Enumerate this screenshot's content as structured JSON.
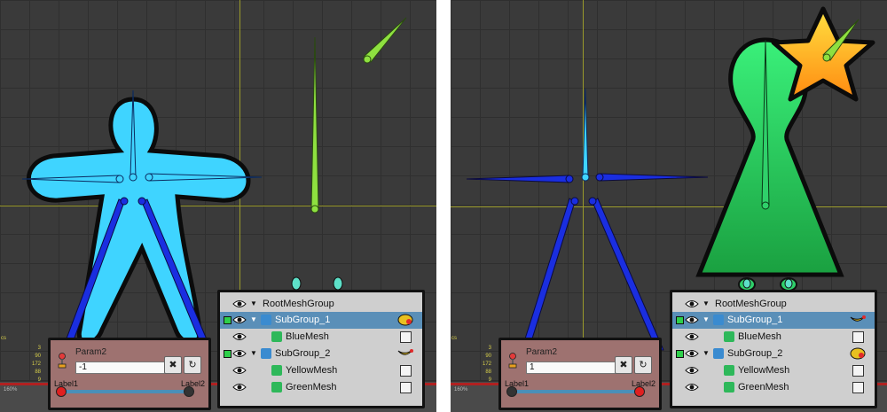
{
  "colors": {
    "viewport_bg": "#3a3a3a",
    "blue_body": "#3fd4ff",
    "blue_limb": "#1a2ee0",
    "green_bone": "#8ee040",
    "tree_green": "#2fd06a",
    "selection": "#5a8fb8",
    "param_panel": "#9e7270"
  },
  "left": {
    "param": {
      "name": "Param2",
      "value": "-1",
      "label_min": "Label1",
      "label_max": "Label2",
      "slider_position": 0.0,
      "reset_icon": "x-icon",
      "refresh_icon": "refresh-icon"
    },
    "zoom": "160%",
    "stats_label": "cs",
    "stats": [
      "3",
      "90",
      "172",
      "88",
      "9"
    ]
  },
  "right": {
    "param": {
      "name": "Param2",
      "value": "1",
      "label_min": "Label1",
      "label_max": "Label2",
      "slider_position": 1.0,
      "reset_icon": "x-icon",
      "refresh_icon": "refresh-icon"
    },
    "zoom": "160%",
    "stats_label": "cs",
    "stats": [
      "3",
      "90",
      "172",
      "88",
      "9"
    ]
  },
  "hierarchy": {
    "root": "RootMeshGroup",
    "items": [
      {
        "label": "SubGroup_1",
        "type": "group"
      },
      {
        "label": "BlueMesh",
        "type": "mesh"
      },
      {
        "label": "SubGroup_2",
        "type": "group"
      },
      {
        "label": "YellowMesh",
        "type": "mesh"
      },
      {
        "label": "GreenMesh",
        "type": "mesh"
      }
    ]
  }
}
